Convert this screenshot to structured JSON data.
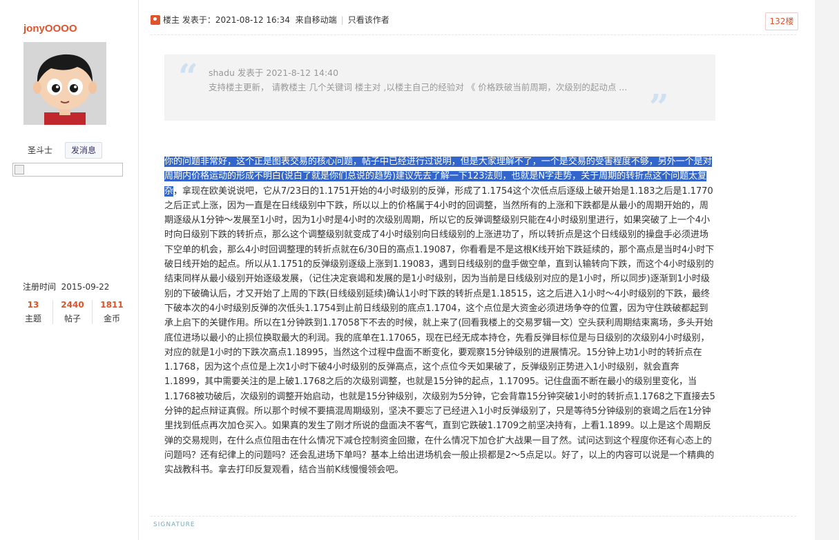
{
  "author": {
    "username": "jonyOOOO",
    "rank": "圣斗士",
    "message_button": "发消息",
    "register_label": "注册时间",
    "register_date": "2015-09-22",
    "stats": [
      {
        "value": "13",
        "label": "主题"
      },
      {
        "value": "2440",
        "label": "帖子"
      },
      {
        "value": "1811",
        "label": "金币"
      }
    ]
  },
  "post": {
    "host_label": "楼主",
    "posted_label": "发表于：2021-08-12 16:34",
    "source": "来自移动端",
    "only_author": "只看该作者",
    "floor": "132楼"
  },
  "quote": {
    "author_line": "shadu 发表于 2021-8-12 14:40",
    "text": "支持楼主更新， 请教楼主 几个关键词 楼主对 ,以楼主自己的经验对 《 价格跌破当前周期，次级别的起动点 ..."
  },
  "content": {
    "highlighted": "你的问题非常好，这个正是图表交易的核心问题，帖子中已经进行过说明，但是大家理解不了，一个是交易的受害程度不够，另外一个是对周期内价格运动的形成不明白(说白了就是你们总说的趋势)建议先去了解一下123法则，也就是N字走势，关于周期的转折点这个问题太复杂",
    "body": "，拿现在欧美说说吧，它从7/23日的1.1751开始的4小时级别的反弹，形成了1.1754这个次低点后逐级上破开始是1.183之后是1.1770之后正式上涨，因为一直是在日线级别中下跌，所以以上的价格属于4小时的回调整，当然所有的上涨和下跌都是从最小的周期开始的，周期逐级从1分钟～发展至1小时，因为1小时是4小时的次级别周期，所以它的反弹调整级别只能在4小时级别里进行，如果突破了上一个4小时向日级别下跌的转折点，那么这个调整级别就变成了4小时级别向日线级别的上涨进功了，所以转折点是这个日线级别的操盘手必须进场下空单的机会，那么4小时回调整理的转折点就在6/30日的高点1.19087，你看看是不是这根K线开始下跌延续的，那个高点是当时4小时下破日线开始的起点。所以从1.1751的反弹级别逐级上涨到1.19083，遇到日线级别的盘手做空单，直到认输转向下跌，而这个4小时级别的结束同样从最小级别开始逐级发展，（记住决定衰竭和发展的是1小时级别，因为当前是日线级别对应的是1小时，所以同步)逐渐到1小时级别的下破确认后，才又开始了上周的下跌(日线级别延续)确认1小时下跌的转折点是1.18515，这之后进入1小时～4小时级别的下跌，最终下破本次的4小时级别反弹的次低头1.1754到止前日线级别的底点1.1704，这个点位是大资金必须进场争夺的位置，因为守住跌破都起到承上启下的关键作用。所以在1分钟跌到1.17058下不去的时候，就上来了(回看我楼上的交易罗辑一文）空头获利周期结束离场，多头开始底位进场以最小的止损位换取最大的利润。我的底单在1.17065，现在已经无成本持仓，先看反弹目标位是与日级别的次级别4小时级别，对应的就是1小时的下跌次高点1.18995，当然这个过程中盘面不断变化，要观察15分钟级别的进展情况。15分钟上功1小时的转折点在1.1768，因为这个点位是上次1小时下破4小时级别的反弹高点，这个点位今天如果破了，反弹级别正势进入1小时级别，就会直奔1.1899，其中需要关注的是上破1.1768之后的次级别调整，也就是15分钟的起点，1.17095。记住盘面不断在最小的级别里变化，当1.1768被功破后，次级别的调整开始启动，也就是15分钟级别，次级别为5分钟，它会背靠15分钟突破1小时的转折点1.1768之下直接去5分钟的起点辩证真假。所以那个时候不要搞混周期级别，坚决不要忘了已经进入1小时反弹级别了，只是等待5分钟级别的衰竭之后在1分钟里找到低点再次加仓买入。如果真的发生了刚才所说的盘面决不客气，直到它跌破1.1709之前坚决持有，上看1.1899。以上是这个周期反弹的交易规则，在什么点位阻击在什么情况下减仓控制资金回撤，在什么情况下加仓扩大战果一目了然。试问达到这个程度你还有心态上的问题吗？还有纪律上的问题吗？还会乱进场下单吗？基本上给出进场机会一般止损都是2～5点足以。好了，以上的内容可以说是一个精典的实战教科书。拿去打印反复观看，结合当前K线慢慢领会吧。"
  },
  "signature_label": "SIGNATURE"
}
